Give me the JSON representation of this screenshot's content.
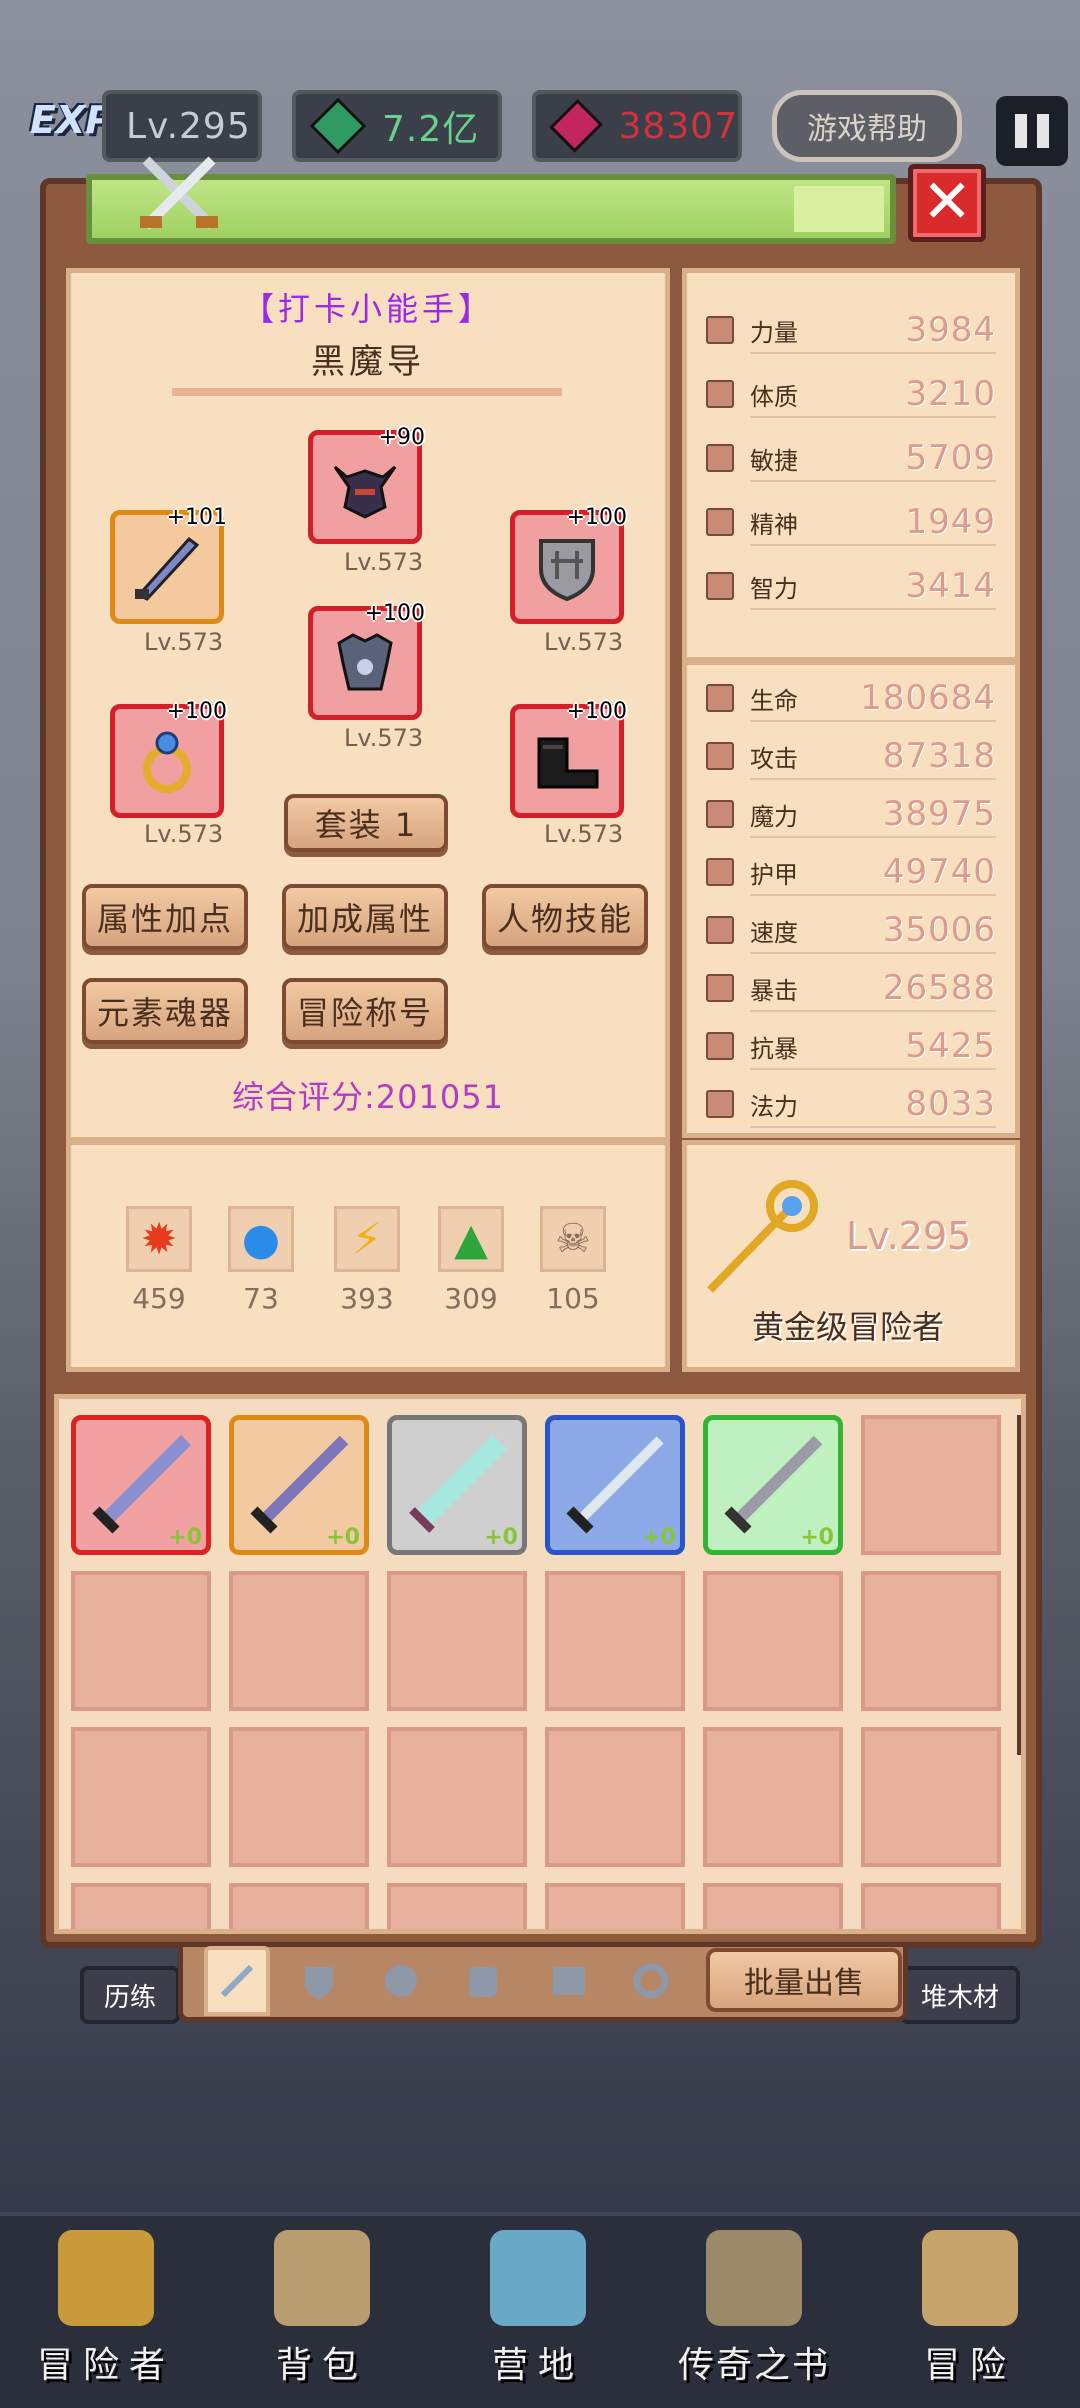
{
  "top": {
    "exp_badge": "EXP",
    "level": "Lv.295",
    "emerald": "7.2亿",
    "ruby": "38307",
    "help": "游戏帮助"
  },
  "equip": {
    "title": "【打卡小能手】",
    "name": "黑魔导",
    "slots": [
      {
        "plus": "+90",
        "lv": "Lv.573",
        "icon": "helmet-icon"
      },
      {
        "plus": "+101",
        "lv": "Lv.573",
        "icon": "sword-icon"
      },
      {
        "plus": "+100",
        "lv": "Lv.573",
        "icon": "shield-icon"
      },
      {
        "plus": "+100",
        "lv": "Lv.573",
        "icon": "armor-icon"
      },
      {
        "plus": "+100",
        "lv": "Lv.573",
        "icon": "ring-icon"
      },
      {
        "plus": "+100",
        "lv": "Lv.573",
        "icon": "boots-icon"
      }
    ],
    "set_button": "套装 1",
    "buttons": [
      "属性加点",
      "加成属性",
      "人物技能",
      "元素魂器",
      "冒险称号"
    ],
    "score": "综合评分:201051"
  },
  "materials": [
    {
      "icon": "fire-essence-icon",
      "count": "459"
    },
    {
      "icon": "water-essence-icon",
      "count": "73"
    },
    {
      "icon": "lightning-essence-icon",
      "count": "393"
    },
    {
      "icon": "nature-essence-icon",
      "count": "309"
    },
    {
      "icon": "skull-essence-icon",
      "count": "105"
    }
  ],
  "base_stats": [
    {
      "label": "力量",
      "value": "3984"
    },
    {
      "label": "体质",
      "value": "3210"
    },
    {
      "label": "敏捷",
      "value": "5709"
    },
    {
      "label": "精神",
      "value": "1949"
    },
    {
      "label": "智力",
      "value": "3414"
    }
  ],
  "combat_stats": [
    {
      "label": "生命",
      "value": "180684"
    },
    {
      "label": "攻击",
      "value": "87318"
    },
    {
      "label": "魔力",
      "value": "38975"
    },
    {
      "label": "护甲",
      "value": "49740"
    },
    {
      "label": "速度",
      "value": "35006"
    },
    {
      "label": "暴击",
      "value": "26588"
    },
    {
      "label": "抗暴",
      "value": "5425"
    },
    {
      "label": "法力",
      "value": "8033"
    }
  ],
  "rank": {
    "level": "Lv.295",
    "title": "黄金级冒险者"
  },
  "inventory": [
    {
      "plus": "+0",
      "bg": "#f1a1a1",
      "border": "#d22"
    },
    {
      "plus": "+0",
      "bg": "#f3c9a2",
      "border": "#e08a16"
    },
    {
      "plus": "+0",
      "bg": "#cfcfcf",
      "border": "#777"
    },
    {
      "plus": "+0",
      "bg": "#8ea9e8",
      "border": "#2a54c7"
    },
    {
      "plus": "+0",
      "bg": "#bff0bf",
      "border": "#33b533"
    }
  ],
  "tabs": [
    "weapon-tab-icon",
    "shield-tab-icon",
    "helmet-tab-icon",
    "armor-tab-icon",
    "boots-tab-icon",
    "ring-tab-icon"
  ],
  "sell_button": "批量出售",
  "side_tabs": {
    "left": "历练",
    "right": "堆木材"
  },
  "bottom_nav": [
    "冒险者",
    "背包",
    "营地",
    "传奇之书",
    "冒险"
  ]
}
